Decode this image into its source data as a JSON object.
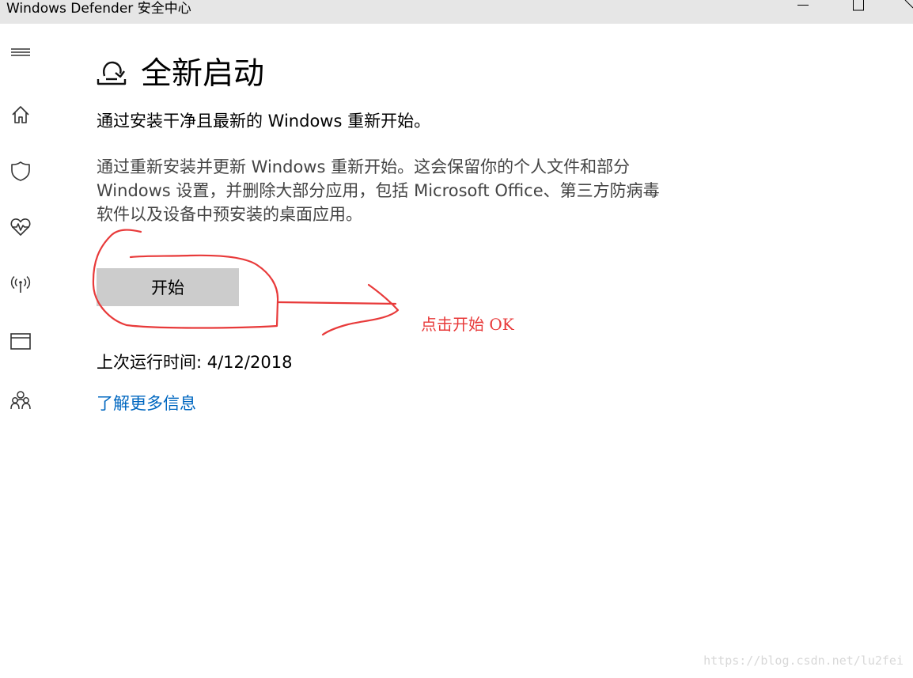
{
  "window": {
    "title": "Windows Defender 安全中心"
  },
  "sidebar": {
    "items": [
      {
        "icon": "hamburger-menu-icon"
      },
      {
        "icon": "home-icon"
      },
      {
        "icon": "shield-icon"
      },
      {
        "icon": "heart-pulse-icon"
      },
      {
        "icon": "wireless-network-icon"
      },
      {
        "icon": "app-browser-icon"
      },
      {
        "icon": "family-icon"
      }
    ]
  },
  "main": {
    "icon": "fresh-start-icon",
    "title": "全新启动",
    "subtitle": "通过安装干净且最新的 Windows 重新开始。",
    "description": "通过重新安装并更新 Windows 重新开始。这会保留你的个人文件和部分 Windows 设置，并删除大部分应用，包括 Microsoft Office、第三方防病毒软件以及设备中预安装的桌面应用。",
    "start_button": "开始",
    "last_run": "上次运行时间: 4/12/2018",
    "learn_more": "了解更多信息"
  },
  "annotation": {
    "text": "点击开始 OK",
    "color": "#e83a3a"
  },
  "watermark": "https://blog.csdn.net/lu2fei",
  "colors": {
    "link": "#0067c0",
    "button_bg": "#cccccc",
    "titlebar_bg": "#e6e6e6"
  }
}
